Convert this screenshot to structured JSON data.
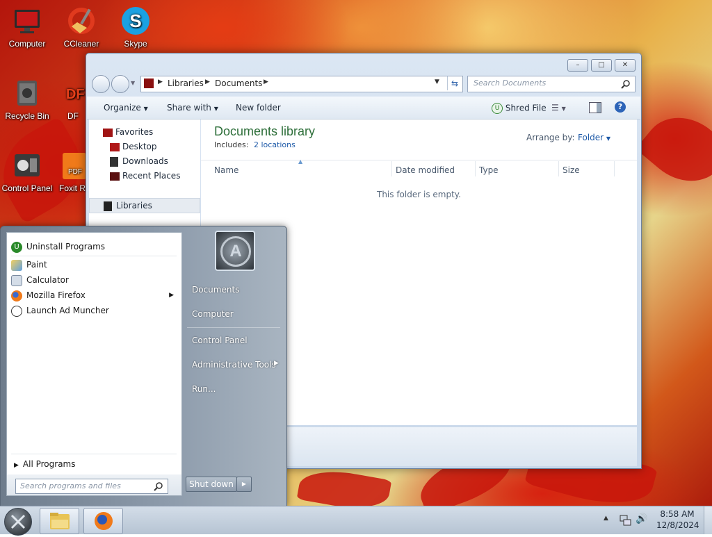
{
  "desktop": {
    "icons": [
      {
        "label": "Computer"
      },
      {
        "label": "CCleaner"
      },
      {
        "label": "Skype"
      },
      {
        "label": "Recycle Bin"
      },
      {
        "label": "DF"
      },
      {
        "label": "Control Panel"
      },
      {
        "label": "Foxit R"
      }
    ]
  },
  "explorer": {
    "address": {
      "crumbs": [
        "Libraries",
        "Documents"
      ]
    },
    "search_placeholder": "Search Documents",
    "toolbar": {
      "organize": "Organize",
      "share_with": "Share with",
      "new_folder": "New folder",
      "shred_file": "Shred File"
    },
    "nav": {
      "favorites": "Favorites",
      "items": [
        "Desktop",
        "Downloads",
        "Recent Places"
      ],
      "libraries": "Libraries"
    },
    "library": {
      "title": "Documents library",
      "includes_label": "Includes:",
      "includes_link": "2 locations",
      "arrange_label": "Arrange by:",
      "arrange_value": "Folder"
    },
    "columns": [
      "Name",
      "Date modified",
      "Type",
      "Size"
    ],
    "empty_message": "This folder is empty."
  },
  "start_menu": {
    "pinned": [
      "Uninstall Programs"
    ],
    "recent": [
      "Paint",
      "Calculator",
      "Mozilla Firefox",
      "Launch Ad Muncher"
    ],
    "all_programs": "All Programs",
    "search_placeholder": "Search programs and files",
    "right_items": [
      "Documents",
      "Computer",
      "Control Panel",
      "Administrative Tools",
      "Run..."
    ],
    "shutdown": "Shut down"
  },
  "taskbar": {
    "time": "8:58 AM",
    "date": "12/8/2024"
  },
  "colors": {
    "accent_blue": "#1e5aa8",
    "library_title": "#2e6f3a",
    "taskbar": "#c5d2e1"
  }
}
